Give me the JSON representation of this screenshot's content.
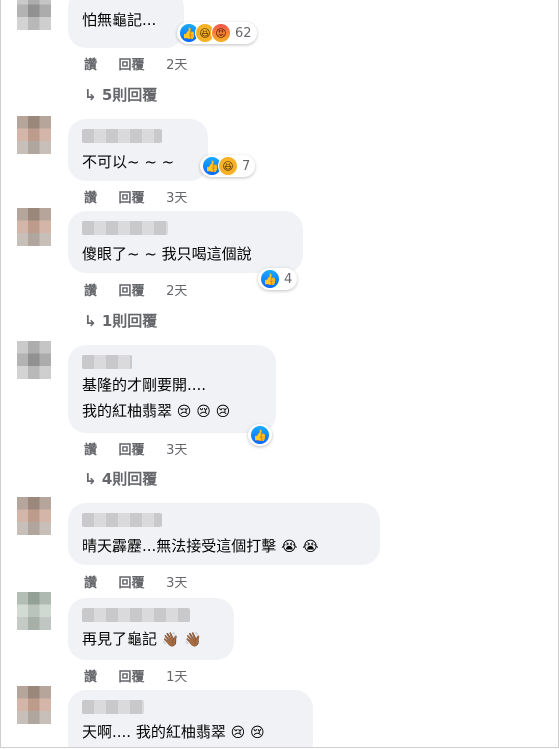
{
  "actions": {
    "like": "讚",
    "reply": "回覆"
  },
  "comments": [
    {
      "text": "怕無龜記...",
      "reaction_count": "62",
      "time": "2天",
      "replies": "5則回覆"
    },
    {
      "text": "不可以~ ~ ~",
      "reaction_count": "7",
      "time": "3天"
    },
    {
      "text": "傻眼了~ ~ 我只喝這個說",
      "reaction_count": "4",
      "time": "2天",
      "replies": "1則回覆"
    },
    {
      "line1": "基隆的才剛要開....",
      "line2": "我的紅柚翡翠",
      "time": "3天",
      "replies": "4則回覆"
    },
    {
      "text": "晴天霹靂...無法接受這個打擊",
      "time": "3天"
    },
    {
      "text": "再見了龜記",
      "time": "1天"
    },
    {
      "text": "天啊.... 我的紅柚翡翠"
    }
  ],
  "icons": {
    "reply_arrow": "↳",
    "sad": "😢",
    "cry": "😭",
    "wave": "👋🏾",
    "like": "👍",
    "haha": "😆",
    "angry": "😡"
  }
}
